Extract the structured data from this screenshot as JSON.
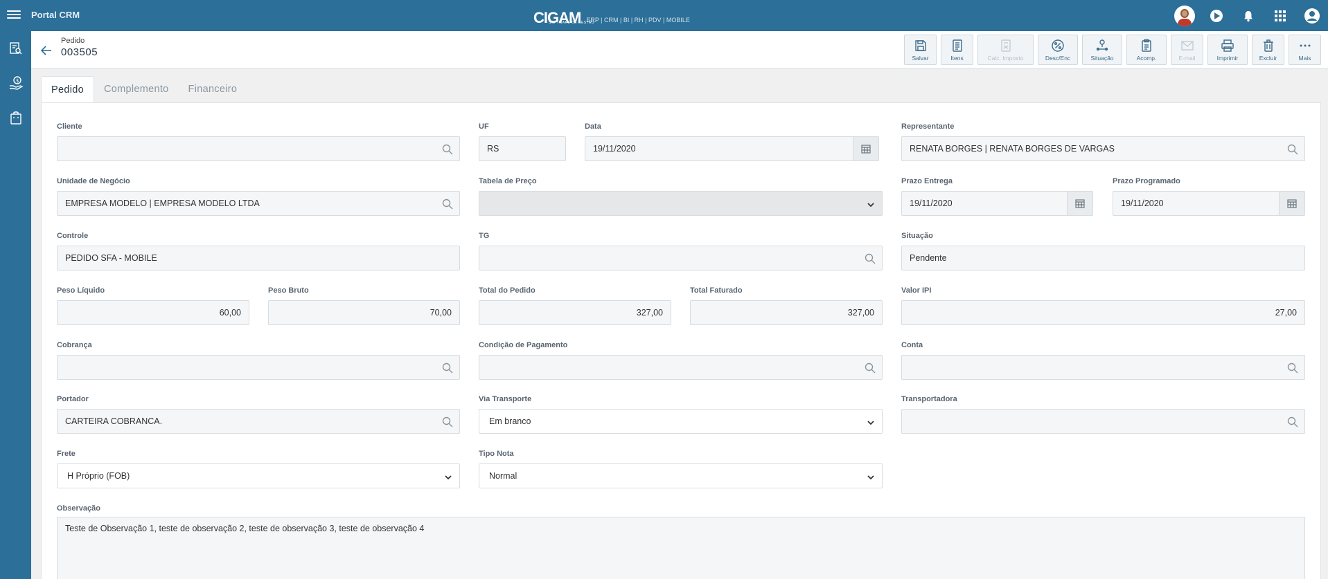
{
  "topbar": {
    "app_title": "Portal CRM",
    "logo_mark": "CIGAM",
    "logo_sub": "SOFTWARE DE GESTÃO",
    "logo_tag": "ERP | CRM | BI | RH | PDV | MOBILE",
    "icons": [
      "menu-icon",
      "avatar",
      "help-icon",
      "bell-icon",
      "apps-grid-icon",
      "user-account-icon"
    ]
  },
  "sidebar": {
    "icons": [
      "report-search-icon",
      "sales-money-icon",
      "shopping-bag-icon"
    ]
  },
  "header": {
    "label": "Pedido",
    "number": "003505"
  },
  "toolbar": {
    "buttons": [
      {
        "label": "Salvar",
        "icon": "save-icon",
        "enabled": true
      },
      {
        "label": "Itens",
        "icon": "items-list-icon",
        "enabled": true
      },
      {
        "label": "Calc. Imposto",
        "icon": "calc-tax-icon",
        "enabled": false
      },
      {
        "label": "Desc/Enc",
        "icon": "percent-icon",
        "enabled": true
      },
      {
        "label": "Situação",
        "icon": "status-flow-icon",
        "enabled": true
      },
      {
        "label": "Acomp.",
        "icon": "tracking-clipboard-icon",
        "enabled": true
      },
      {
        "label": "E-mail",
        "icon": "email-icon",
        "enabled": false
      },
      {
        "label": "Imprimir",
        "icon": "print-icon",
        "enabled": true
      },
      {
        "label": "Excluir",
        "icon": "trash-icon",
        "enabled": true
      },
      {
        "label": "Mais",
        "icon": "more-icon",
        "enabled": true
      }
    ]
  },
  "tabs": [
    "Pedido",
    "Complemento",
    "Financeiro"
  ],
  "form": {
    "cliente": {
      "label": "Cliente",
      "value": ""
    },
    "uf": {
      "label": "UF",
      "value": "RS"
    },
    "data": {
      "label": "Data",
      "value": "19/11/2020"
    },
    "representante": {
      "label": "Representante",
      "value": "RENATA BORGES | RENATA BORGES DE VARGAS"
    },
    "unidade": {
      "label": "Unidade de Negócio",
      "value": "EMPRESA MODELO | EMPRESA MODELO LTDA"
    },
    "tabela_preco": {
      "label": "Tabela de Preço",
      "value": ""
    },
    "prazo_entrega": {
      "label": "Prazo Entrega",
      "value": "19/11/2020"
    },
    "prazo_programado": {
      "label": "Prazo Programado",
      "value": "19/11/2020"
    },
    "controle": {
      "label": "Controle",
      "value": "PEDIDO SFA - MOBILE"
    },
    "tg": {
      "label": "TG",
      "value": ""
    },
    "situacao": {
      "label": "Situação",
      "value": "Pendente"
    },
    "peso_liquido": {
      "label": "Peso Líquido",
      "value": "60,00"
    },
    "peso_bruto": {
      "label": "Peso Bruto",
      "value": "70,00"
    },
    "total_pedido": {
      "label": "Total do Pedido",
      "value": "327,00"
    },
    "total_faturado": {
      "label": "Total Faturado",
      "value": "327,00"
    },
    "valor_ipi": {
      "label": "Valor IPI",
      "value": "27,00"
    },
    "cobranca": {
      "label": "Cobrança",
      "value": ""
    },
    "condicao_pagamento": {
      "label": "Condição de Pagamento",
      "value": ""
    },
    "conta": {
      "label": "Conta",
      "value": ""
    },
    "portador": {
      "label": "Portador",
      "value": "CARTEIRA COBRANCA."
    },
    "via_transporte": {
      "label": "Via Transporte",
      "value": "Em branco"
    },
    "transportadora": {
      "label": "Transportadora",
      "value": ""
    },
    "frete": {
      "label": "Frete",
      "value": "H Próprio (FOB)"
    },
    "tipo_nota": {
      "label": "Tipo Nota",
      "value": "Normal"
    },
    "observacao": {
      "label": "Observação",
      "value": "Teste de Observação 1, teste de observação 2, teste de observação 3,  teste de observação 4"
    }
  }
}
